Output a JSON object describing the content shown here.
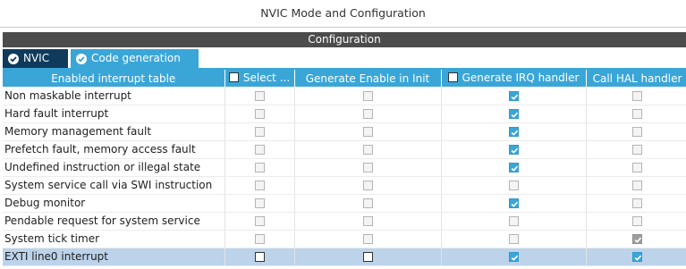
{
  "window": {
    "title": "NVIC Mode and Configuration"
  },
  "section": {
    "title": "Configuration"
  },
  "tabs": [
    {
      "label": "NVIC",
      "active": false,
      "icon": "check-circle-icon"
    },
    {
      "label": "Code generation",
      "active": true,
      "icon": "check-circle-icon"
    }
  ],
  "colors": {
    "accent": "#3aa6d8",
    "tab_dark": "#0f3a5c",
    "section_bar": "#4c4c4c",
    "selected_row": "#bcd3ea"
  },
  "table": {
    "headers": [
      {
        "label": "Enabled interrupt table",
        "has_checkbox": false
      },
      {
        "label": "Select ...",
        "has_checkbox": true
      },
      {
        "label": "Generate Enable in Init",
        "has_checkbox": false
      },
      {
        "label": "Generate IRQ handler",
        "has_checkbox": true
      },
      {
        "label": "Call HAL handler",
        "has_checkbox": false
      }
    ],
    "rows": [
      {
        "name": "Non maskable interrupt",
        "select": "off",
        "enable_init": "off",
        "irq_handler": "on",
        "hal_handler": "off",
        "selected": false
      },
      {
        "name": "Hard fault interrupt",
        "select": "off",
        "enable_init": "off",
        "irq_handler": "on",
        "hal_handler": "off",
        "selected": false
      },
      {
        "name": "Memory management fault",
        "select": "off",
        "enable_init": "off",
        "irq_handler": "on",
        "hal_handler": "off",
        "selected": false
      },
      {
        "name": "Prefetch fault, memory access fault",
        "select": "off",
        "enable_init": "off",
        "irq_handler": "on",
        "hal_handler": "off",
        "selected": false
      },
      {
        "name": "Undefined instruction or illegal state",
        "select": "off",
        "enable_init": "off",
        "irq_handler": "on",
        "hal_handler": "off",
        "selected": false
      },
      {
        "name": "System service call via SWI instruction",
        "select": "off",
        "enable_init": "off",
        "irq_handler": "off",
        "hal_handler": "off",
        "selected": false
      },
      {
        "name": "Debug monitor",
        "select": "off",
        "enable_init": "off",
        "irq_handler": "on",
        "hal_handler": "off",
        "selected": false
      },
      {
        "name": "Pendable request for system service",
        "select": "off",
        "enable_init": "off",
        "irq_handler": "off",
        "hal_handler": "off",
        "selected": false
      },
      {
        "name": "System tick timer",
        "select": "off",
        "enable_init": "off",
        "irq_handler": "off",
        "hal_handler": "ondis",
        "selected": false
      },
      {
        "name": "EXTI line0 interrupt",
        "select": "off-white",
        "enable_init": "off-white",
        "irq_handler": "on",
        "hal_handler": "on",
        "selected": true
      }
    ]
  }
}
